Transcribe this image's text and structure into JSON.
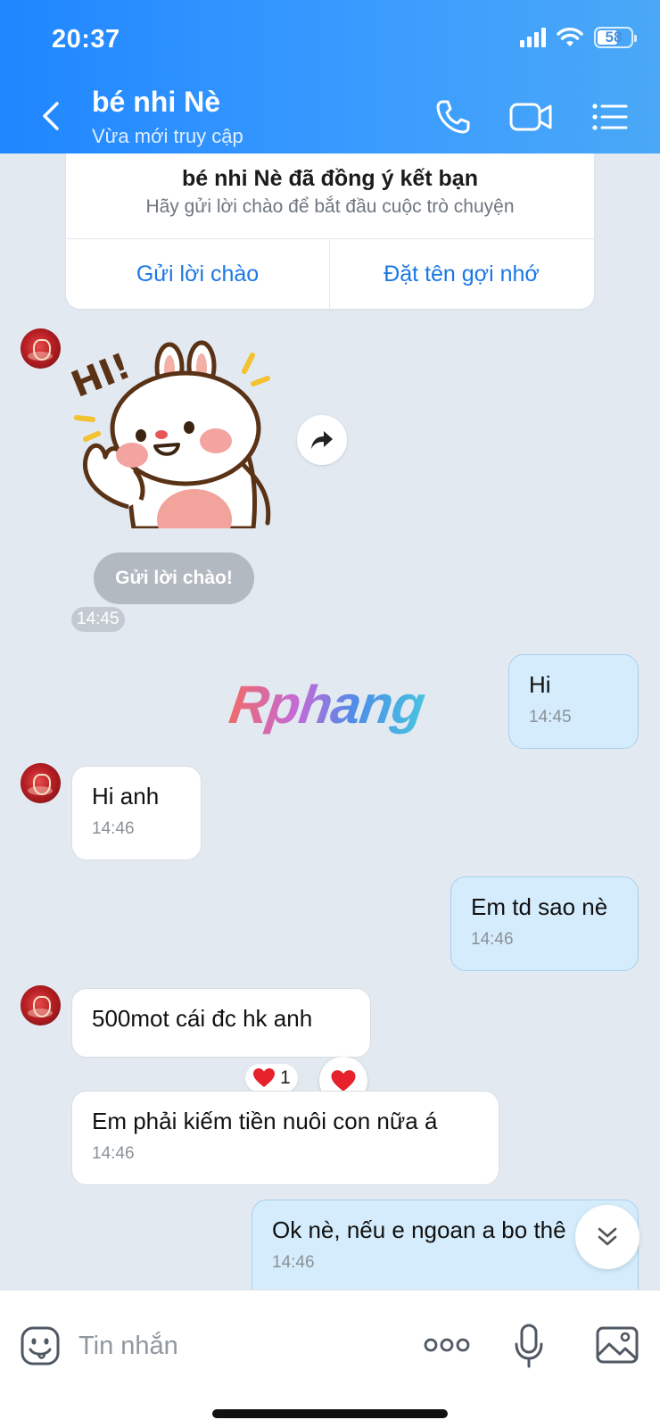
{
  "status_bar": {
    "time": "20:37",
    "battery": "58"
  },
  "header": {
    "title": "bé nhi Nè",
    "subtitle": "Vừa mới truy cập"
  },
  "friend_card": {
    "title": "bé nhi Nè đã đồng ý kết bạn",
    "subtitle": "Hãy gửi lời chào để bắt đầu cuộc trò chuyện",
    "left_button": "Gửi lời chào",
    "right_button": "Đặt tên gợi nhớ"
  },
  "sticker": {
    "text": "HI!"
  },
  "greeting_chip": "Gửi lời chào!",
  "greeting_time": "14:45",
  "watermark": "Rphang",
  "messages": [
    {
      "side": "out",
      "text": "Hi",
      "time": "14:45"
    },
    {
      "side": "in",
      "text": "Hi anh",
      "time": "14:46"
    },
    {
      "side": "out",
      "text": "Em td sao nè",
      "time": "14:46"
    },
    {
      "side": "in",
      "text": "500mot cái đc hk anh",
      "time": ""
    },
    {
      "side": "in",
      "text": "Em phải kiếm tiền nuôi con nữa á",
      "time": "14:46"
    },
    {
      "side": "out",
      "text": "Ok nè, nếu e ngoan a bo thê",
      "time": "14:46"
    }
  ],
  "reaction": {
    "emoji": "heart",
    "count": "1"
  },
  "input": {
    "placeholder": "Tin nhắn"
  },
  "colors": {
    "header": "#2a8fff",
    "accent": "#1a78e6",
    "out_bubble": "#d4ecfb",
    "in_bubble": "#ffffff",
    "background": "#e2e9f1"
  }
}
